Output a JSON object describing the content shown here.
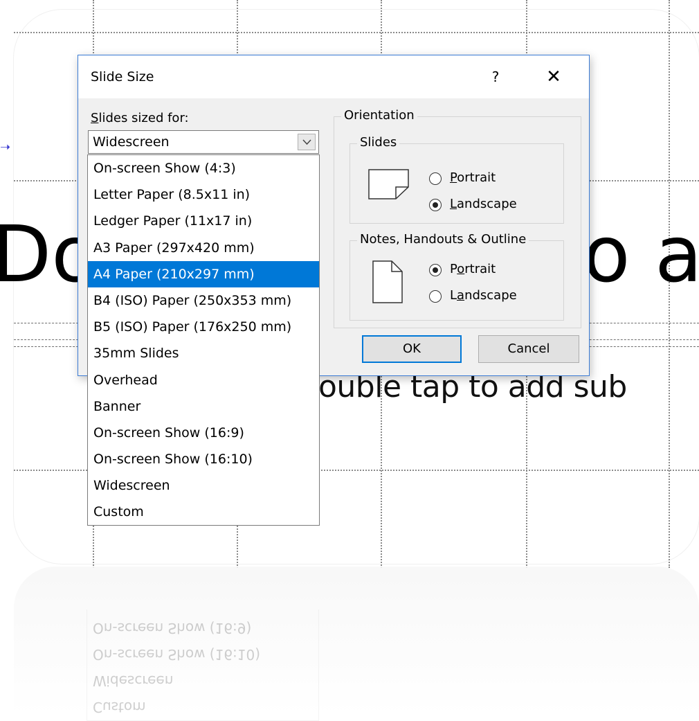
{
  "slide": {
    "title_left": "Do",
    "title_right": "o a",
    "subtitle": "Double tap to add sub",
    "subtitle_visible": "ouble tap to add sub"
  },
  "dialog": {
    "title": "Slide Size",
    "help_label": "?",
    "close_label": "✕",
    "sized_for_label": "Slides sized for:",
    "selected_size": "Widescreen",
    "orientation_group": "Orientation",
    "slides_group": "Slides",
    "slides_portrait": "Portrait",
    "slides_landscape": "Landscape",
    "slides_selected": "Landscape",
    "notes_group": "Notes, Handouts & Outline",
    "notes_portrait": "Portrait",
    "notes_landscape": "Landscape",
    "notes_selected": "Portrait",
    "ok_label": "OK",
    "cancel_label": "Cancel"
  },
  "dropdown": {
    "items": [
      "On-screen Show (4:3)",
      "Letter Paper (8.5x11 in)",
      "Ledger Paper (11x17 in)",
      "A3 Paper (297x420 mm)",
      "A4 Paper (210x297 mm)",
      "B4 (ISO) Paper (250x353 mm)",
      "B5 (ISO) Paper (176x250 mm)",
      "35mm Slides",
      "Overhead",
      "Banner",
      "On-screen Show (16:9)",
      "On-screen Show (16:10)",
      "Widescreen",
      "Custom"
    ],
    "highlighted_index": 4
  },
  "reflection": {
    "items": [
      "Custom",
      "Widescreen",
      "On-screen Show (16:10)",
      "On-screen Show (16:9)"
    ]
  },
  "colors": {
    "accent": "#0078d7",
    "dialog_bg": "#f0f0f0"
  }
}
